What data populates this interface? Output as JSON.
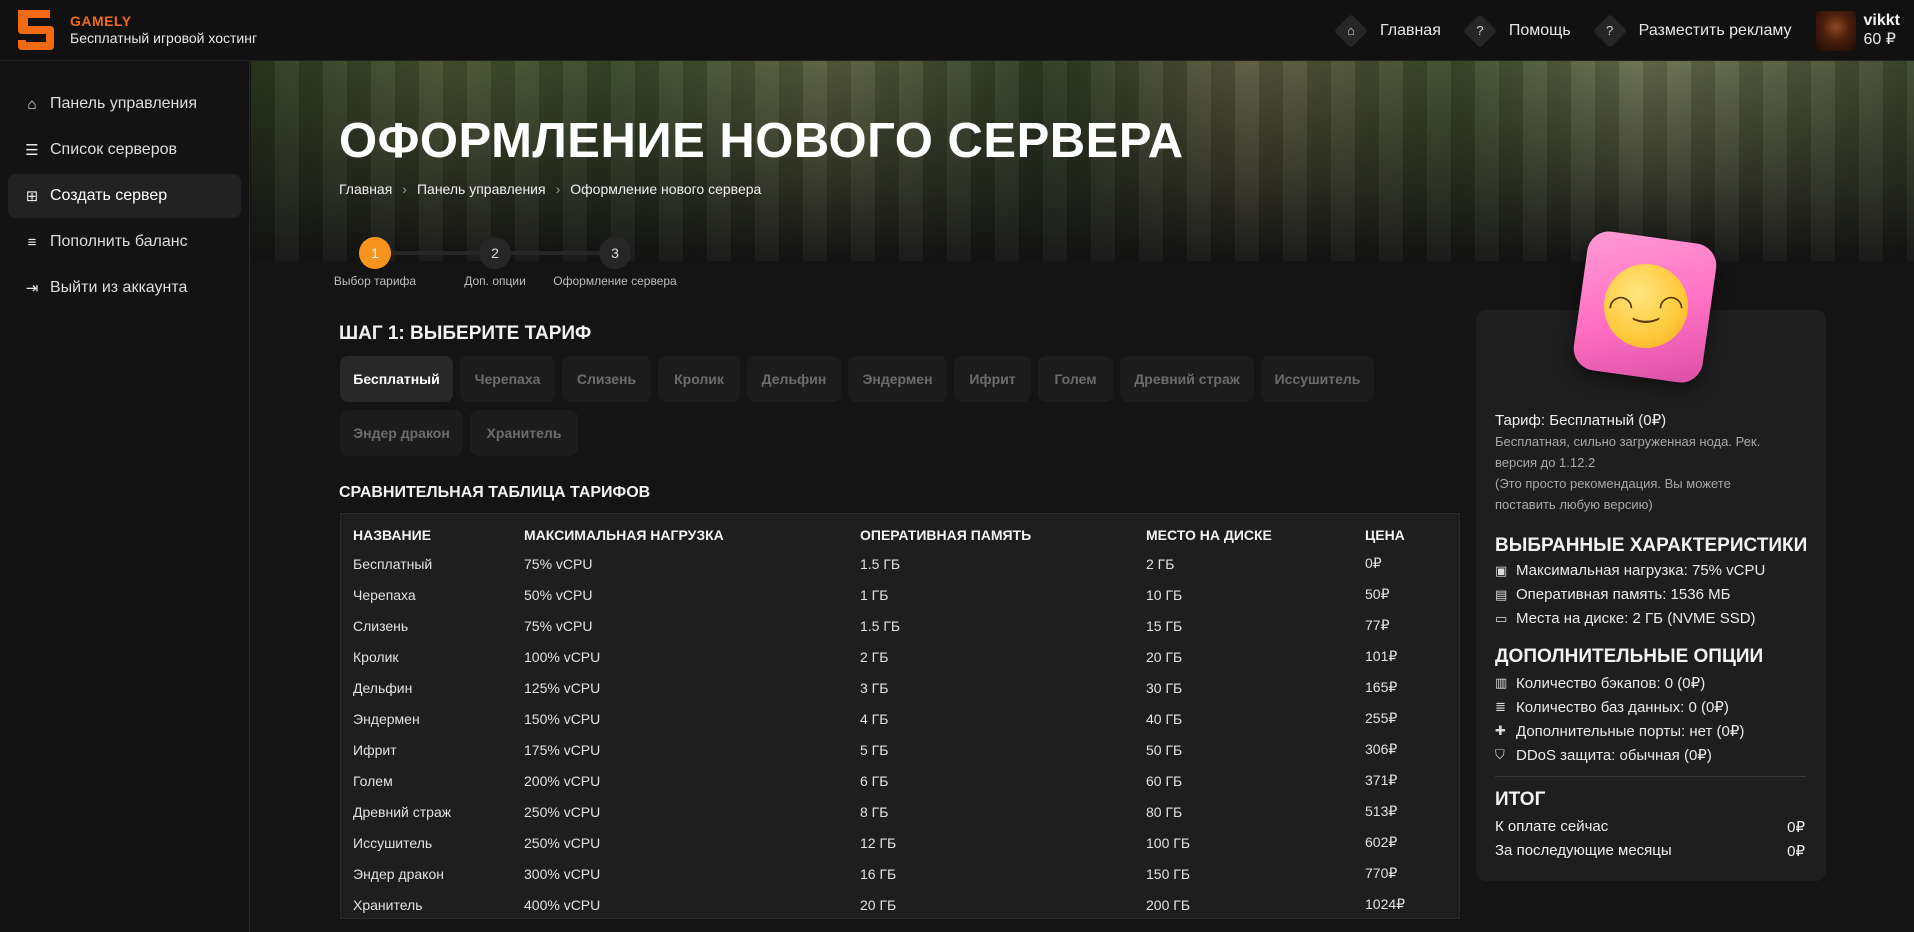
{
  "brand": {
    "name": "GAMELY",
    "subtitle": "Бесплатный игровой хостинг"
  },
  "topnav": {
    "home": "Главная",
    "help": "Помощь",
    "ads": "Разместить рекламу"
  },
  "user": {
    "name": "vikkt",
    "balance": "60 ₽"
  },
  "sidebar": {
    "items": [
      {
        "label": "Панель управления",
        "icon": "home-icon"
      },
      {
        "label": "Список серверов",
        "icon": "server-list-icon"
      },
      {
        "label": "Создать сервер",
        "icon": "plus-square-icon"
      },
      {
        "label": "Пополнить баланс",
        "icon": "coins-icon"
      },
      {
        "label": "Выйти из аккаунта",
        "icon": "logout-icon"
      }
    ],
    "active_index": 2
  },
  "page": {
    "title": "ОФОРМЛЕНИЕ НОВОГО СЕРВЕРА",
    "breadcrumb": [
      "Главная",
      "Панель управления",
      "Оформление нового сервера"
    ]
  },
  "steps": [
    {
      "number": "1",
      "label": "Выбор тарифа"
    },
    {
      "number": "2",
      "label": "Доп. опции"
    },
    {
      "number": "3",
      "label": "Оформление сервера"
    }
  ],
  "current_step": 1,
  "tariff_section": {
    "title": "ШАГ 1: ВЫБЕРИТЕ ТАРИФ",
    "tabs": [
      "Бесплатный",
      "Черепаха",
      "Слизень",
      "Кролик",
      "Дельфин",
      "Эндермен",
      "Ифрит",
      "Голем",
      "Древний страж",
      "Иссушитель",
      "Эндер дракон",
      "Хранитель"
    ],
    "selected": "Бесплатный"
  },
  "comparison": {
    "title": "СРАВНИТЕЛЬНАЯ ТАБЛИЦА ТАРИФОВ",
    "headers": [
      "НАЗВАНИЕ",
      "МАКСИМАЛЬНАЯ НАГРУЗКА",
      "ОПЕРАТИВНАЯ ПАМЯТЬ",
      "МЕСТО НА ДИСКЕ",
      "ЦЕНА"
    ],
    "rows": [
      [
        "Бесплатный",
        "75% vCPU",
        "1.5 ГБ",
        "2 ГБ",
        "0₽"
      ],
      [
        "Черепаха",
        "50% vCPU",
        "1 ГБ",
        "10 ГБ",
        "50₽"
      ],
      [
        "Слизень",
        "75% vCPU",
        "1.5 ГБ",
        "15 ГБ",
        "77₽"
      ],
      [
        "Кролик",
        "100% vCPU",
        "2 ГБ",
        "20 ГБ",
        "101₽"
      ],
      [
        "Дельфин",
        "125% vCPU",
        "3 ГБ",
        "30 ГБ",
        "165₽"
      ],
      [
        "Эндермен",
        "150% vCPU",
        "4 ГБ",
        "40 ГБ",
        "255₽"
      ],
      [
        "Ифрит",
        "175% vCPU",
        "5 ГБ",
        "50 ГБ",
        "306₽"
      ],
      [
        "Голем",
        "200% vCPU",
        "6 ГБ",
        "60 ГБ",
        "371₽"
      ],
      [
        "Древний страж",
        "250% vCPU",
        "8 ГБ",
        "80 ГБ",
        "513₽"
      ],
      [
        "Иссушитель",
        "250% vCPU",
        "12 ГБ",
        "100 ГБ",
        "602₽"
      ],
      [
        "Эндер дракон",
        "300% vCPU",
        "16 ГБ",
        "150 ГБ",
        "770₽"
      ],
      [
        "Хранитель",
        "400% vCPU",
        "20 ГБ",
        "200 ГБ",
        "1024₽"
      ]
    ]
  },
  "summary": {
    "tariff": "Тариф: Бесплатный (0₽)",
    "note": "Бесплатная, сильно загруженная нода. Рек. версия до 1.12.2",
    "note2": "(Это просто рекомендация. Вы можете поставить любую версию)",
    "specs_title": "ВЫБРАННЫЕ ХАРАКТЕРИСТИКИ",
    "specs": [
      "Максимальная нагрузка: 75% vCPU",
      "Оперативная память: 1536 МБ",
      "Места на диске: 2 ГБ (NVME SSD)"
    ],
    "options_title": "ДОПОЛНИТЕЛЬНЫЕ ОПЦИИ",
    "options": [
      "Количество бэкапов: 0 (0₽)",
      "Количество баз данных: 0 (0₽)",
      "Дополнительные порты: нет (0₽)",
      "DDoS защита: обычная (0₽)"
    ],
    "total_title": "ИТОГ",
    "pay_now_label": "К оплате сейчас",
    "pay_now_value": "0₽",
    "monthly_label": "За последующие месяцы",
    "monthly_value": "0₽"
  },
  "colors": {
    "accent": "#f06a14",
    "step_active": "#f7931e",
    "background": "#141414",
    "panel": "#1e1e1e"
  }
}
